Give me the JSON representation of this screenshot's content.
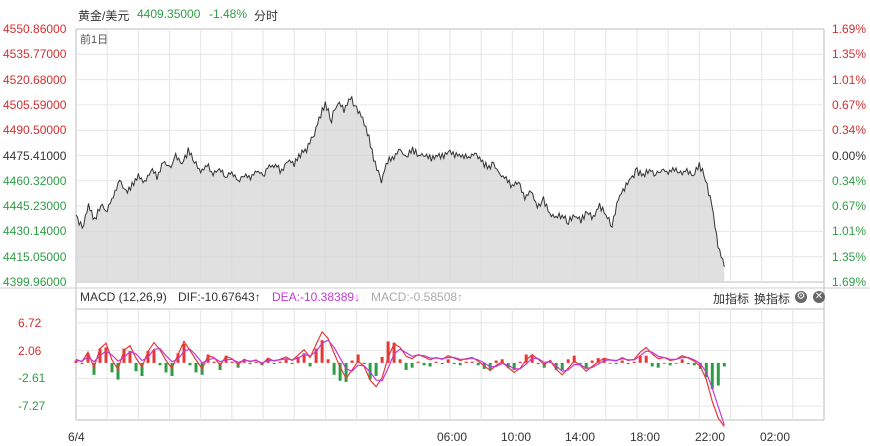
{
  "header": {
    "symbol": "黄金/美元",
    "price": "4409.35000",
    "change": "-1.48%",
    "period": "分时",
    "day_tag": "前1日"
  },
  "price_axis": {
    "left": [
      "4550.86000",
      "4535.77000",
      "4520.68000",
      "4505.59000",
      "4490.50000",
      "4475.41000",
      "4460.32000",
      "4445.23000",
      "4430.14000",
      "4415.05000",
      "4399.96000"
    ],
    "right": [
      "1.69%",
      "1.35%",
      "1.01%",
      "0.67%",
      "0.34%",
      "0.00%",
      "0.34%",
      "0.67%",
      "1.01%",
      "1.35%",
      "1.69%"
    ]
  },
  "macd": {
    "title": "MACD (12,26,9)",
    "dif": "DIF:-10.67643",
    "dif_arrow": "↑",
    "dea": "DEA:-10.38389",
    "dea_arrow": "↓",
    "macd": "MACD:-0.58508",
    "macd_arrow": "↑",
    "axis": [
      "6.72",
      "2.06",
      "-2.61",
      "-7.27"
    ],
    "add_indicator": "加指标",
    "switch_indicator": "换指标"
  },
  "time_axis": [
    "6/4",
    "06:00",
    "10:00",
    "14:00",
    "18:00",
    "22:00",
    "02:00"
  ],
  "colors": {
    "up": "#e53935",
    "down": "#2e9e45",
    "dea": "#c23ad6",
    "neutral": "#333333",
    "grid": "#e6e6e6"
  },
  "chart_data": {
    "type": "line",
    "price_series": {
      "ylim": [
        4399.96,
        4550.86
      ],
      "points": [
        [
          0,
          4440
        ],
        [
          2,
          4432
        ],
        [
          4,
          4446
        ],
        [
          6,
          4437
        ],
        [
          8,
          4447
        ],
        [
          10,
          4442
        ],
        [
          12,
          4452
        ],
        [
          14,
          4461
        ],
        [
          16,
          4453
        ],
        [
          18,
          4458
        ],
        [
          20,
          4463
        ],
        [
          22,
          4459
        ],
        [
          24,
          4468
        ],
        [
          26,
          4462
        ],
        [
          28,
          4473
        ],
        [
          30,
          4467
        ],
        [
          32,
          4476
        ],
        [
          34,
          4470
        ],
        [
          36,
          4478
        ],
        [
          38,
          4472
        ],
        [
          40,
          4466
        ],
        [
          42,
          4470
        ],
        [
          44,
          4464
        ],
        [
          46,
          4467
        ],
        [
          48,
          4462
        ],
        [
          50,
          4465
        ],
        [
          52,
          4461
        ],
        [
          54,
          4464
        ],
        [
          56,
          4462
        ],
        [
          58,
          4467
        ],
        [
          60,
          4463
        ],
        [
          62,
          4468
        ],
        [
          64,
          4470
        ],
        [
          66,
          4466
        ],
        [
          68,
          4473
        ],
        [
          70,
          4470
        ],
        [
          72,
          4476
        ],
        [
          74,
          4479
        ],
        [
          76,
          4486
        ],
        [
          78,
          4498
        ],
        [
          80,
          4506
        ],
        [
          82,
          4497
        ],
        [
          84,
          4508
        ],
        [
          86,
          4502
        ],
        [
          88,
          4510
        ],
        [
          90,
          4503
        ],
        [
          92,
          4497
        ],
        [
          94,
          4486
        ],
        [
          96,
          4470
        ],
        [
          98,
          4461
        ],
        [
          100,
          4472
        ],
        [
          102,
          4475
        ],
        [
          104,
          4478
        ],
        [
          106,
          4474
        ],
        [
          108,
          4479
        ],
        [
          110,
          4475
        ],
        [
          112,
          4477
        ],
        [
          114,
          4473
        ],
        [
          116,
          4476
        ],
        [
          118,
          4475
        ],
        [
          120,
          4478
        ],
        [
          122,
          4475
        ],
        [
          124,
          4476
        ],
        [
          126,
          4474
        ],
        [
          128,
          4477
        ],
        [
          130,
          4473
        ],
        [
          132,
          4468
        ],
        [
          134,
          4470
        ],
        [
          136,
          4464
        ],
        [
          138,
          4461
        ],
        [
          140,
          4457
        ],
        [
          142,
          4460
        ],
        [
          144,
          4451
        ],
        [
          146,
          4454
        ],
        [
          148,
          4445
        ],
        [
          150,
          4449
        ],
        [
          152,
          4441
        ],
        [
          154,
          4438
        ],
        [
          156,
          4440
        ],
        [
          158,
          4436
        ],
        [
          160,
          4439
        ],
        [
          162,
          4437
        ],
        [
          164,
          4441
        ],
        [
          166,
          4438
        ],
        [
          168,
          4446
        ],
        [
          170,
          4440
        ],
        [
          172,
          4433
        ],
        [
          174,
          4450
        ],
        [
          176,
          4456
        ],
        [
          178,
          4462
        ],
        [
          180,
          4466
        ],
        [
          182,
          4463
        ],
        [
          184,
          4467
        ],
        [
          186,
          4464
        ],
        [
          188,
          4468
        ],
        [
          190,
          4465
        ],
        [
          192,
          4467
        ],
        [
          194,
          4464
        ],
        [
          196,
          4467
        ],
        [
          198,
          4463
        ],
        [
          200,
          4470
        ],
        [
          202,
          4461
        ],
        [
          204,
          4446
        ],
        [
          206,
          4422
        ],
        [
          208,
          4409
        ]
      ]
    },
    "macd_series": {
      "ylim": [
        -9.6,
        9.05
      ],
      "dif": [
        0.6,
        0.2,
        1.8,
        -0.8,
        2.4,
        3.3,
        0.5,
        -1.1,
        2.1,
        2.9,
        0.8,
        -0.7,
        1.9,
        3.4,
        2.2,
        0.4,
        -0.9,
        1.4,
        3.6,
        2.1,
        0.5,
        -1.0,
        1.2,
        0.9,
        -0.4,
        1.1,
        0.7,
        -0.3,
        0.6,
        0.2,
        0.5,
        -0.2,
        0.8,
        0.3,
        0.6,
        1.0,
        0.4,
        1.3,
        2.2,
        0.9,
        3.1,
        5.2,
        4.1,
        1.6,
        -0.7,
        -2.6,
        -1.2,
        0.3,
        -0.6,
        -2.9,
        -4.0,
        -2.5,
        0.9,
        3.2,
        2.6,
        1.1,
        0.7,
        1.4,
        1.0,
        0.5,
        0.9,
        0.6,
        1.2,
        0.8,
        0.4,
        0.7,
        0.9,
        0.3,
        -0.5,
        -1.3,
        -0.4,
        0.2,
        -0.8,
        -1.6,
        -0.9,
        0.5,
        1.4,
        0.6,
        -0.3,
        0.4,
        -1.1,
        -2.0,
        -0.9,
        0.3,
        -0.4,
        -1.4,
        -0.6,
        0.2,
        0.8,
        0.5,
        0.3,
        0.9,
        0.4,
        0.6,
        1.8,
        2.6,
        1.5,
        0.7,
        0.9,
        0.4,
        0.6,
        1.2,
        0.8,
        0.3,
        -0.6,
        -2.8,
        -6.5,
        -9.3,
        -10.7
      ],
      "dea": [
        0.4,
        0.3,
        1.0,
        0.2,
        1.2,
        2.0,
        1.3,
        0.3,
        0.9,
        1.9,
        1.5,
        0.4,
        0.9,
        2.3,
        2.4,
        1.2,
        0.2,
        0.6,
        2.0,
        2.3,
        1.3,
        0.0,
        0.5,
        0.8,
        0.2,
        0.5,
        0.6,
        0.1,
        0.4,
        0.3,
        0.4,
        0.0,
        0.4,
        0.4,
        0.5,
        0.7,
        0.5,
        0.8,
        1.4,
        1.2,
        1.9,
        3.3,
        3.8,
        2.6,
        0.8,
        -1.0,
        -1.4,
        -0.4,
        -0.5,
        -1.5,
        -2.9,
        -3.0,
        -0.9,
        1.5,
        2.3,
        1.7,
        1.1,
        1.3,
        1.2,
        0.8,
        0.8,
        0.7,
        0.9,
        0.9,
        0.6,
        0.6,
        0.8,
        0.5,
        0.0,
        -0.7,
        -0.6,
        -0.1,
        -0.4,
        -1.0,
        -1.0,
        -0.2,
        0.8,
        0.7,
        0.1,
        0.2,
        -0.5,
        -1.4,
        -1.2,
        -0.3,
        -0.3,
        -0.9,
        -0.8,
        -0.2,
        0.4,
        0.5,
        0.4,
        0.7,
        0.5,
        0.5,
        1.2,
        2.0,
        1.8,
        1.1,
        0.9,
        0.6,
        0.6,
        0.9,
        0.9,
        0.5,
        -0.1,
        -1.6,
        -4.3,
        -7.4,
        -10.4
      ]
    }
  }
}
